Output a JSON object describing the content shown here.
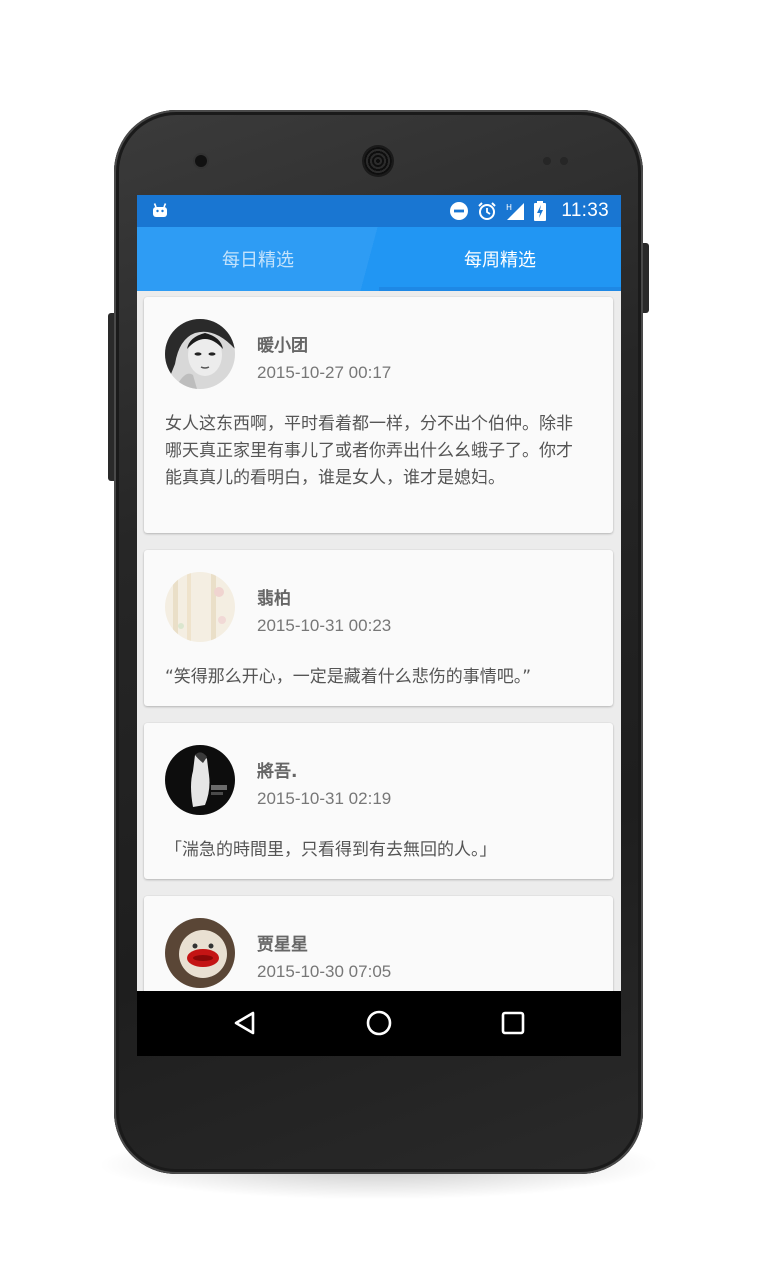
{
  "status_bar": {
    "time": "11:33",
    "icons": [
      "android-notification-icon",
      "do-not-disturb-icon",
      "alarm-icon",
      "signal-icon",
      "battery-charging-icon"
    ]
  },
  "tabs": [
    {
      "label": "每日精选",
      "selected": false
    },
    {
      "label": "每周精选",
      "selected": true
    }
  ],
  "posts": [
    {
      "author": "暖小团",
      "time": "2015-10-27 00:17",
      "text": "女人这东西啊，平时看着都一样，分不出个伯仲。除非哪天真正家里有事儿了或者你弄出什么幺蛾子了。你才能真真儿的看明白，谁是女人，谁才是媳妇。"
    },
    {
      "author": "翡柏",
      "time": "2015-10-31 00:23",
      "text": "“笑得那么开心，一定是藏着什么悲伤的事情吧。”"
    },
    {
      "author": "將吾.",
      "time": "2015-10-31 02:19",
      "text": "「湍急的時間里，只看得到有去無回的人。」"
    },
    {
      "author": "贾星星",
      "time": "2015-10-30 07:05",
      "text": ""
    }
  ],
  "nav": {
    "icons": [
      "back-icon",
      "home-icon",
      "recents-icon"
    ]
  },
  "colors": {
    "primary": "#2196f3",
    "status_bar": "#1976d2",
    "card": "#fafafa"
  }
}
